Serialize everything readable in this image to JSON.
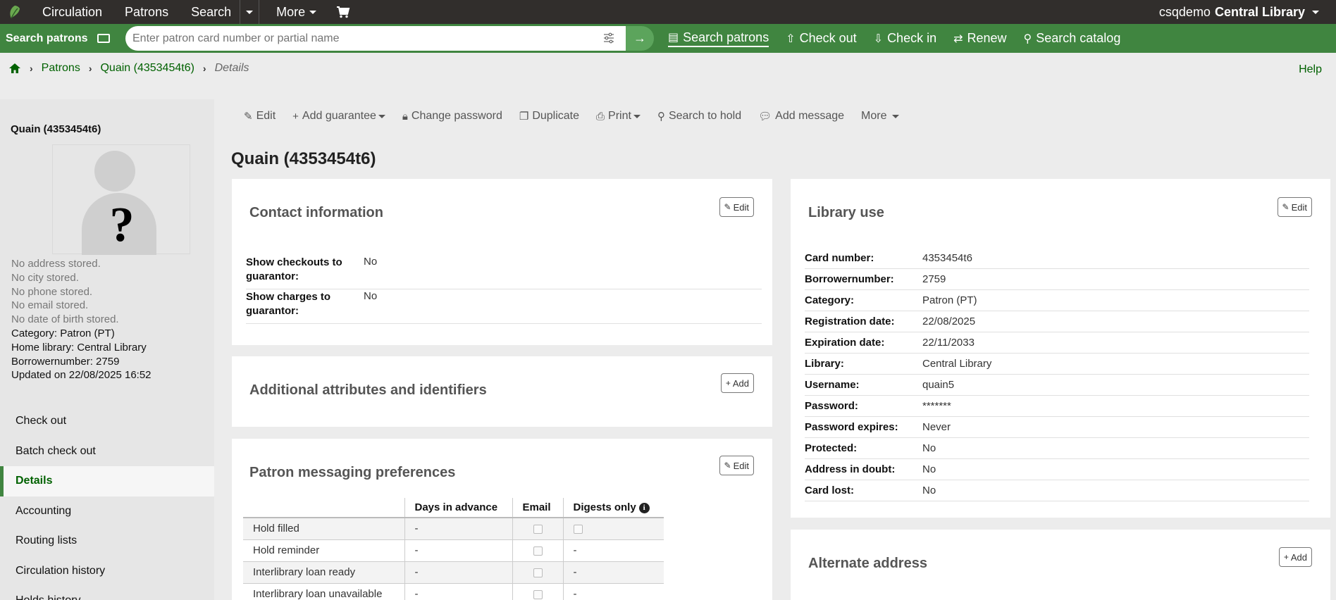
{
  "topnav": {
    "items": [
      "Circulation",
      "Patrons",
      "Search",
      "More"
    ],
    "user": "csqdemo",
    "library": "Central Library"
  },
  "header": {
    "label": "Search patrons",
    "search_placeholder": "Enter patron card number or partial name",
    "links": [
      "Search patrons",
      "Check out",
      "Check in",
      "Renew",
      "Search catalog"
    ]
  },
  "breadcrumb": {
    "patrons": "Patrons",
    "patron": "Quain (4353454t6)",
    "current": "Details"
  },
  "help": "Help",
  "sidebar": {
    "name": "Quain (4353454t6)",
    "no_address": "No address stored.",
    "no_city": "No city stored.",
    "no_phone": "No phone stored.",
    "no_email": "No email stored.",
    "no_dob": "No date of birth stored.",
    "category": "Category: Patron (PT)",
    "home_library": "Home library: Central Library",
    "borrowernumber": "Borrowernumber: 2759",
    "updated": "Updated on 22/08/2025 16:52",
    "menu": [
      "Check out",
      "Batch check out",
      "Details",
      "Accounting",
      "Routing lists",
      "Circulation history",
      "Holds history"
    ]
  },
  "toolbar": {
    "edit": "Edit",
    "add_guarantee": "Add guarantee",
    "change_password": "Change password",
    "duplicate": "Duplicate",
    "print": "Print",
    "search_to_hold": "Search to hold",
    "add_message": "Add message",
    "more": "More"
  },
  "page_title": "Quain (4353454t6)",
  "contact": {
    "title": "Contact information",
    "edit": "Edit",
    "rows": [
      {
        "k1": "Show checkouts to",
        "k2": "guarantor:",
        "v": "No"
      },
      {
        "k1": "Show charges to",
        "k2": "guarantor:",
        "v": "No"
      }
    ]
  },
  "attributes": {
    "title": "Additional attributes and identifiers",
    "add": "Add"
  },
  "messaging": {
    "title": "Patron messaging preferences",
    "edit": "Edit",
    "headers": [
      "",
      "Days in advance",
      "Email",
      "Digests only"
    ],
    "rows": [
      {
        "name": "Hold filled",
        "days": "-",
        "digest": ""
      },
      {
        "name": "Hold reminder",
        "days": "-",
        "digest": "-"
      },
      {
        "name": "Interlibrary loan ready",
        "days": "-",
        "digest": "-"
      },
      {
        "name": "Interlibrary loan unavailable",
        "days": "-",
        "digest": "-"
      }
    ]
  },
  "library_use": {
    "title": "Library use",
    "edit": "Edit",
    "rows": [
      {
        "k": "Card number:",
        "v": "4353454t6"
      },
      {
        "k": "Borrowernumber:",
        "v": "2759"
      },
      {
        "k": "Category:",
        "v": "Patron (PT)"
      },
      {
        "k": "Registration date:",
        "v": "22/08/2025"
      },
      {
        "k": "Expiration date:",
        "v": "22/11/2033"
      },
      {
        "k": "Library:",
        "v": "Central Library"
      },
      {
        "k": "Username:",
        "v": "quain5"
      },
      {
        "k": "Password:",
        "v": "*******"
      },
      {
        "k": "Password expires:",
        "v": "Never"
      },
      {
        "k": "Protected:",
        "v": "No"
      },
      {
        "k": "Address in doubt:",
        "v": "No"
      },
      {
        "k": "Card lost:",
        "v": "No"
      }
    ]
  },
  "alternate": {
    "title": "Alternate address",
    "add": "Add"
  },
  "colors": {
    "nav_bg": "#312e2c",
    "header_green": "#408540",
    "link_green": "#006100"
  }
}
